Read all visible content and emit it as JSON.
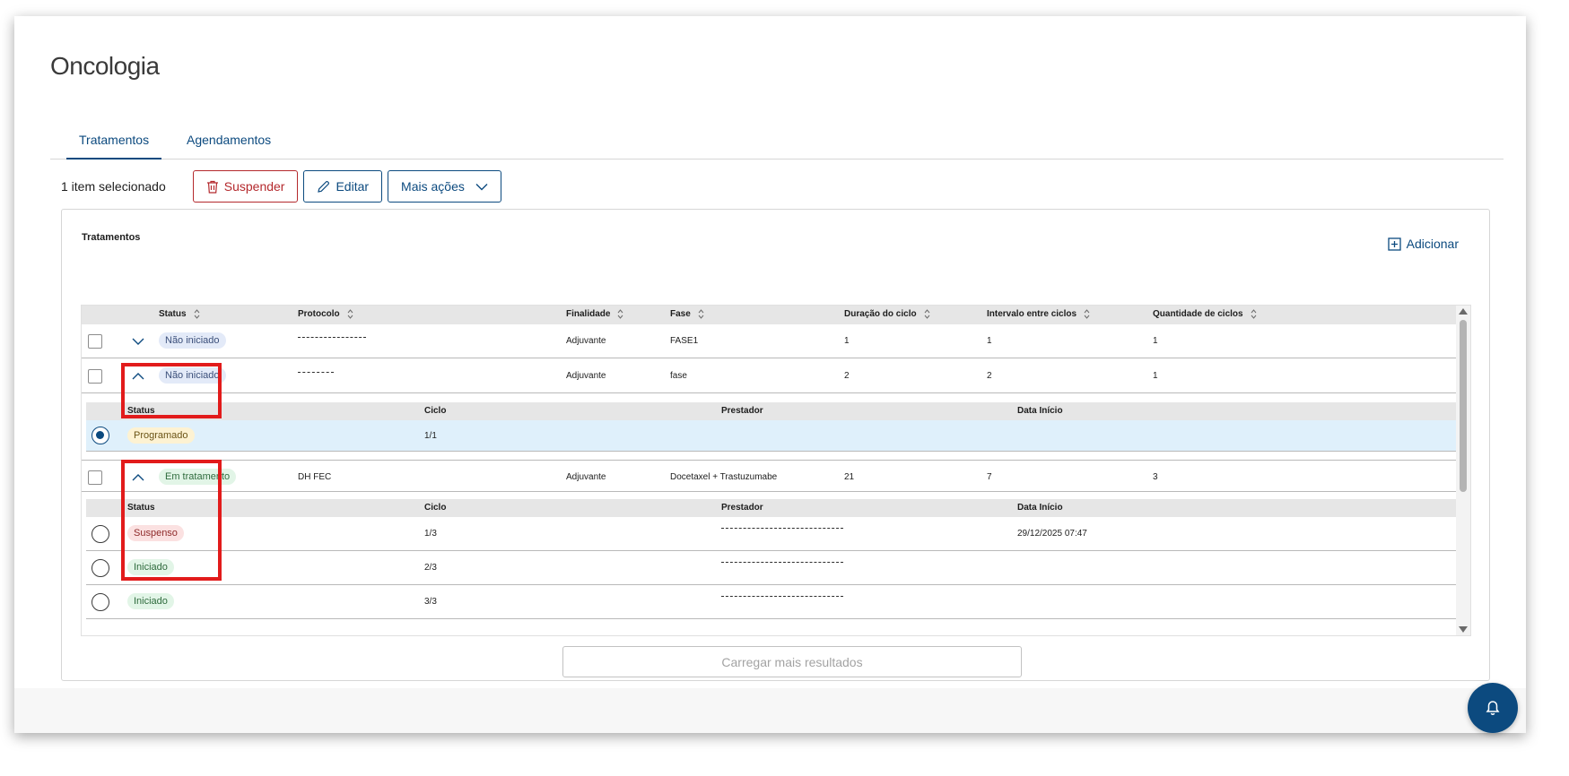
{
  "page": {
    "title": "Oncologia"
  },
  "tabs": [
    {
      "label": "Tratamentos",
      "active": true
    },
    {
      "label": "Agendamentos",
      "active": false
    }
  ],
  "selection": {
    "count_label": "1 item selecionado",
    "suspend_label": "Suspender",
    "edit_label": "Editar",
    "more_label": "Mais ações"
  },
  "card": {
    "title": "Tratamentos",
    "add_label": "Adicionar"
  },
  "columns": [
    "Status",
    "Protocolo",
    "Finalidade",
    "Fase",
    "Duração do ciclo",
    "Intervalo entre ciclos",
    "Quantidade de ciclos"
  ],
  "treatments": [
    {
      "status": "Não iniciado",
      "status_tone": "blue",
      "protocol": "",
      "protocol_masked": true,
      "finalidade": "Adjuvante",
      "fase": "FASE1",
      "duracao": "1",
      "intervalo": "1",
      "quantidade": "1",
      "expanded": false
    },
    {
      "status": "Não iniciado",
      "status_tone": "blue",
      "protocol": "",
      "protocol_masked": true,
      "finalidade": "Adjuvante",
      "fase": "fase",
      "duracao": "2",
      "intervalo": "2",
      "quantidade": "1",
      "expanded": true
    },
    {
      "status": "Em tratamento",
      "status_tone": "green",
      "protocol": "DH FEC",
      "protocol_masked": false,
      "finalidade": "Adjuvante",
      "fase": "Docetaxel + Trastuzumabe",
      "duracao": "21",
      "intervalo": "7",
      "quantidade": "3",
      "expanded": true
    }
  ],
  "cycle_columns": [
    "Status",
    "Ciclo",
    "Prestador",
    "Data Início"
  ],
  "cycles_1": [
    {
      "status": "Programado",
      "status_tone": "yellow",
      "ciclo": "1/1",
      "prestador": "",
      "data": "",
      "selected": true
    }
  ],
  "cycles_2": [
    {
      "status": "Suspenso",
      "status_tone": "red",
      "ciclo": "1/3",
      "prestador_masked": true,
      "data": "29/12/2025 07:47",
      "selected": false
    },
    {
      "status": "Iniciado",
      "status_tone": "green",
      "ciclo": "2/3",
      "prestador_masked": true,
      "data": "",
      "selected": false
    },
    {
      "status": "Iniciado",
      "status_tone": "green",
      "ciclo": "3/3",
      "prestador_masked": true,
      "data": "",
      "selected": false
    }
  ],
  "load_more_label": "Carregar mais resultados",
  "colors": {
    "primary": "#0c4a7f",
    "danger": "#b4292d",
    "highlight": "#e21b1b",
    "selected_row": "#dff0fb"
  },
  "icons": {
    "suspend": "trash-icon",
    "edit": "pencil-icon",
    "more": "chevron-down-icon",
    "add": "plus-square-icon",
    "fab": "bell-icon"
  }
}
